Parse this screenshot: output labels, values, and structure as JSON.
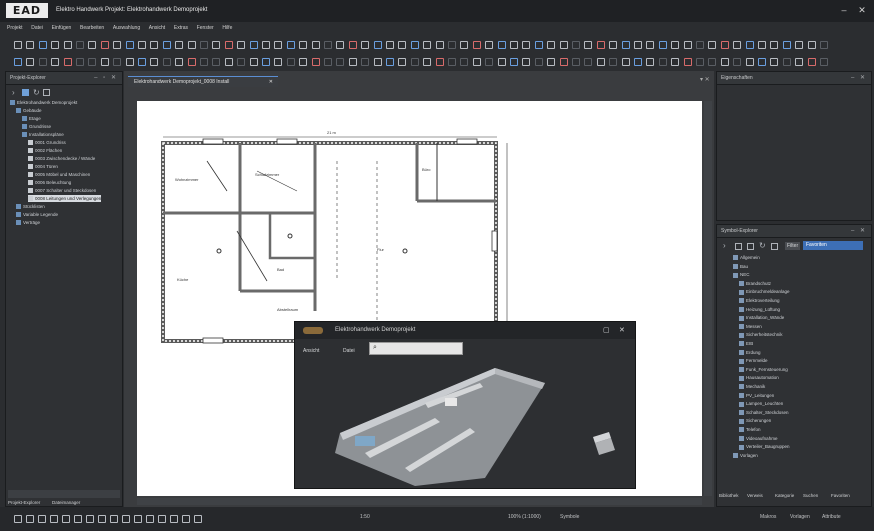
{
  "app": {
    "logo": "EAD",
    "title": "Elektro Handwerk  Projekt: Elektrohandwerk Demoprojekt",
    "window_controls": [
      "–",
      "✕"
    ]
  },
  "menu": [
    "Projekt",
    "Datei",
    "Einfügen",
    "Bearbeiten",
    "Auswahlung",
    "Ansicht",
    "Extras",
    "Fenster",
    "Hilfe"
  ],
  "project_explorer": {
    "title": "Projekt-Explorer",
    "controls": "– ▫ ✕",
    "items": [
      {
        "label": "Elektrohandwerk Demoprojekt",
        "level": 0
      },
      {
        "label": "Gebäude",
        "level": 1
      },
      {
        "label": "Etage",
        "level": 2
      },
      {
        "label": "Grundrisse",
        "level": 2
      },
      {
        "label": "Installationspläne",
        "level": 2
      },
      {
        "label": "0001 Grundriss",
        "level": 3
      },
      {
        "label": "0002 Flächen",
        "level": 3
      },
      {
        "label": "0003 Zwischendecke / Wände",
        "level": 3
      },
      {
        "label": "0004 Türen",
        "level": 3
      },
      {
        "label": "0005 Möbel und Maschinen",
        "level": 3
      },
      {
        "label": "0006 Beleuchtung",
        "level": 3
      },
      {
        "label": "0007 Schalter und Steckdosen",
        "level": 3
      },
      {
        "label": "0008 Leitungen und Verlegungen",
        "level": 3,
        "selected": true
      },
      {
        "label": "Stücklisten",
        "level": 1
      },
      {
        "label": "Variable Legende",
        "level": 1
      },
      {
        "label": "Verträge",
        "level": 1
      }
    ],
    "bottom_tabs": [
      "Projekt-Explorer",
      "Dateimanager"
    ]
  },
  "document": {
    "tab": "Elektrohandwerk Demoprojekt_0008 Install",
    "dimension_label": "21 m",
    "room_labels": [
      "Wohnzimmer",
      "Schlafzimmer",
      "Küche",
      "Bad",
      "Flur",
      "Büro",
      "Abstellraum"
    ]
  },
  "properties": {
    "title": "Eigenschaften",
    "controls": "– ✕"
  },
  "symbol_explorer": {
    "title": "Symbol-Explorer",
    "controls": "– ✕",
    "filter_label": "Filter",
    "filter_value": "Favoriten",
    "items": [
      {
        "label": "Allgemein",
        "level": 1
      },
      {
        "label": "Bau",
        "level": 1
      },
      {
        "label": "NEC",
        "level": 1
      },
      {
        "label": "Brandschutz",
        "level": 2
      },
      {
        "label": "Einbruchmeldeanlage",
        "level": 2
      },
      {
        "label": "Elektroverteilung",
        "level": 2
      },
      {
        "label": "Heizung_Lüftung",
        "level": 2
      },
      {
        "label": "Installation_Wände",
        "level": 2
      },
      {
        "label": "Messen",
        "level": 2
      },
      {
        "label": "Sicherheitstechnik",
        "level": 2
      },
      {
        "label": "EIB",
        "level": 2
      },
      {
        "label": "Erdung",
        "level": 2
      },
      {
        "label": "Fernmelde",
        "level": 2
      },
      {
        "label": "Funk_Fernsteuerung",
        "level": 2
      },
      {
        "label": "Hausautomation",
        "level": 2
      },
      {
        "label": "Mechanik",
        "level": 2
      },
      {
        "label": "PV_Leitungen",
        "level": 2
      },
      {
        "label": "Lampen_Leuchten",
        "level": 2
      },
      {
        "label": "Schalter_Steckdosen",
        "level": 2
      },
      {
        "label": "Sicherungen",
        "level": 2
      },
      {
        "label": "Telefon",
        "level": 2
      },
      {
        "label": "Videoaufnahme",
        "level": 2
      },
      {
        "label": "Verteiler_Baugruppen",
        "level": 2
      },
      {
        "label": "Vorlagen",
        "level": 1
      }
    ],
    "bottom_tabs": [
      "Bibliothek",
      "Verweis",
      "Kategorie",
      "Suchen",
      "Favoriten"
    ]
  },
  "viewer": {
    "title": "Elektrohandwerk Demoprojekt",
    "menu": [
      "Ansicht",
      "Datei"
    ],
    "search_placeholder": "",
    "controls": [
      "▢",
      "✕"
    ]
  },
  "status": {
    "zoom": "100% (1:1000)",
    "scale": "1:50",
    "fields": [
      "Symbole",
      "Makros",
      "Vorlagen",
      "Attribute"
    ]
  }
}
